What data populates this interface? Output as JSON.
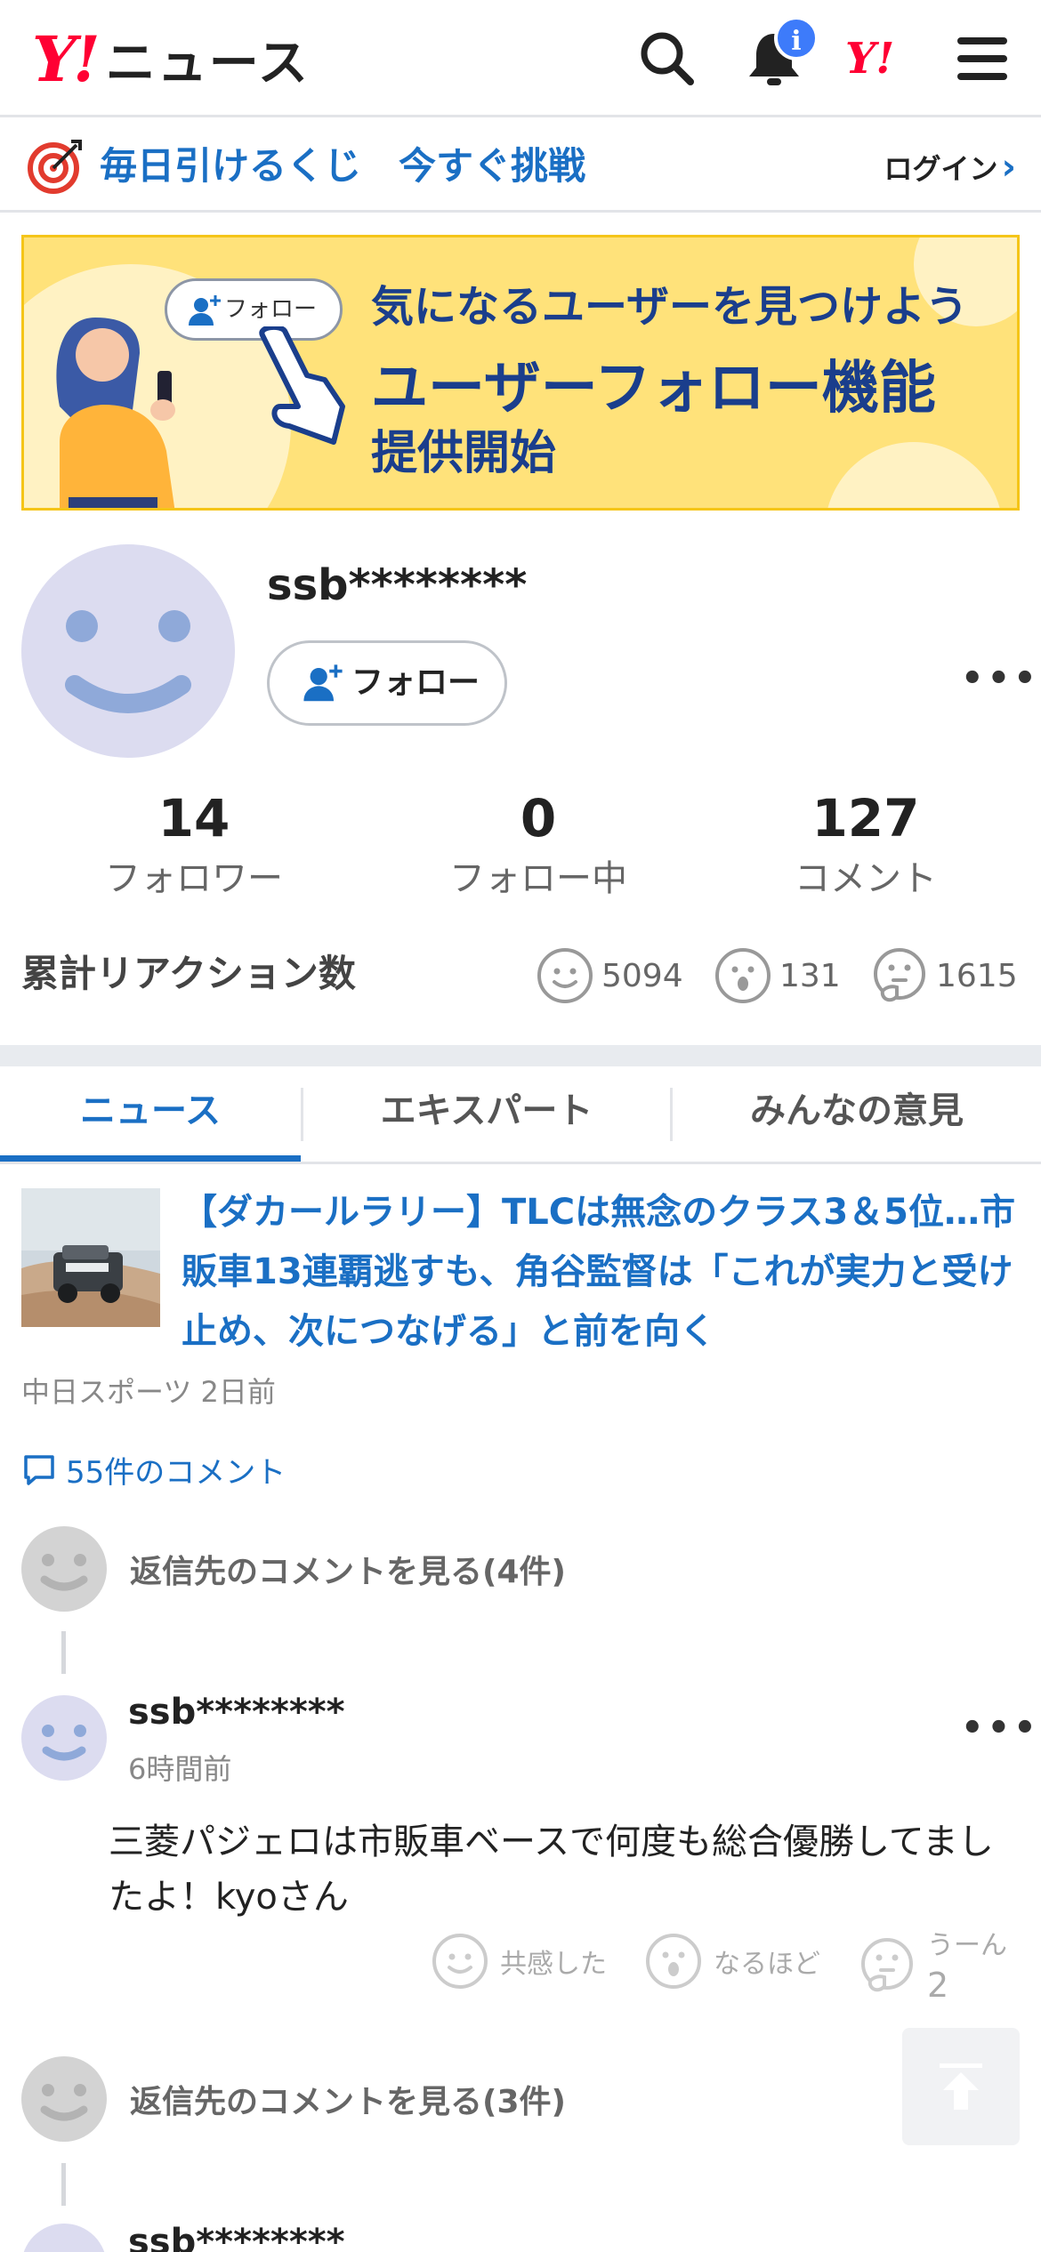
{
  "header": {
    "logo_mark": "Y!",
    "logo_text": "ニュース",
    "notification_badge": "i"
  },
  "lottery": {
    "text": "毎日引けるくじ　今すぐ挑戦",
    "login": "ログイン"
  },
  "banner": {
    "follow_chip": "フォロー",
    "line1": "気になるユーザーを見つけよう",
    "line2": "ユーザーフォロー機能",
    "line3": "提供開始"
  },
  "profile": {
    "username": "ssb********",
    "follow_button": "フォロー",
    "stats": [
      {
        "value": "14",
        "label": "フォロワー"
      },
      {
        "value": "0",
        "label": "フォロー中"
      },
      {
        "value": "127",
        "label": "コメント"
      }
    ],
    "reaction_title": "累計リアクション数",
    "reactions": [
      {
        "icon": "smile-icon",
        "count": "5094"
      },
      {
        "icon": "surprised-icon",
        "count": "131"
      },
      {
        "icon": "thinking-icon",
        "count": "1615"
      }
    ]
  },
  "tabs": [
    "ニュース",
    "エキスパート",
    "みんなの意見"
  ],
  "article": {
    "title": "【ダカールラリー】TLCは無念のクラス3＆5位…市販車13連覇逃すも、角谷監督は「これが実力と受け止め、次につなげる」と前を向く",
    "source": "中日スポーツ 2日前",
    "comment_count": "55件のコメント"
  },
  "replies": [
    {
      "label": "返信先のコメントを見る(4件)"
    },
    {
      "label": "返信先のコメントを見る(3件)"
    }
  ],
  "comment": {
    "user": "ssb********",
    "time": "6時間前",
    "body": "三菱パジェロは市販車ベースで何度も総合優勝してましたよ！kyoさん",
    "react_empathy": "共感した",
    "react_insight": "なるほど",
    "react_hmm": "うーん",
    "react_hmm_count": "2"
  },
  "next_comment_user": "ssb********",
  "colors": {
    "accent": "#1a6fc4",
    "brand_red": "#ff0033",
    "banner_bg": "#ffe27a",
    "avatar_bg": "#dcdcf0"
  }
}
